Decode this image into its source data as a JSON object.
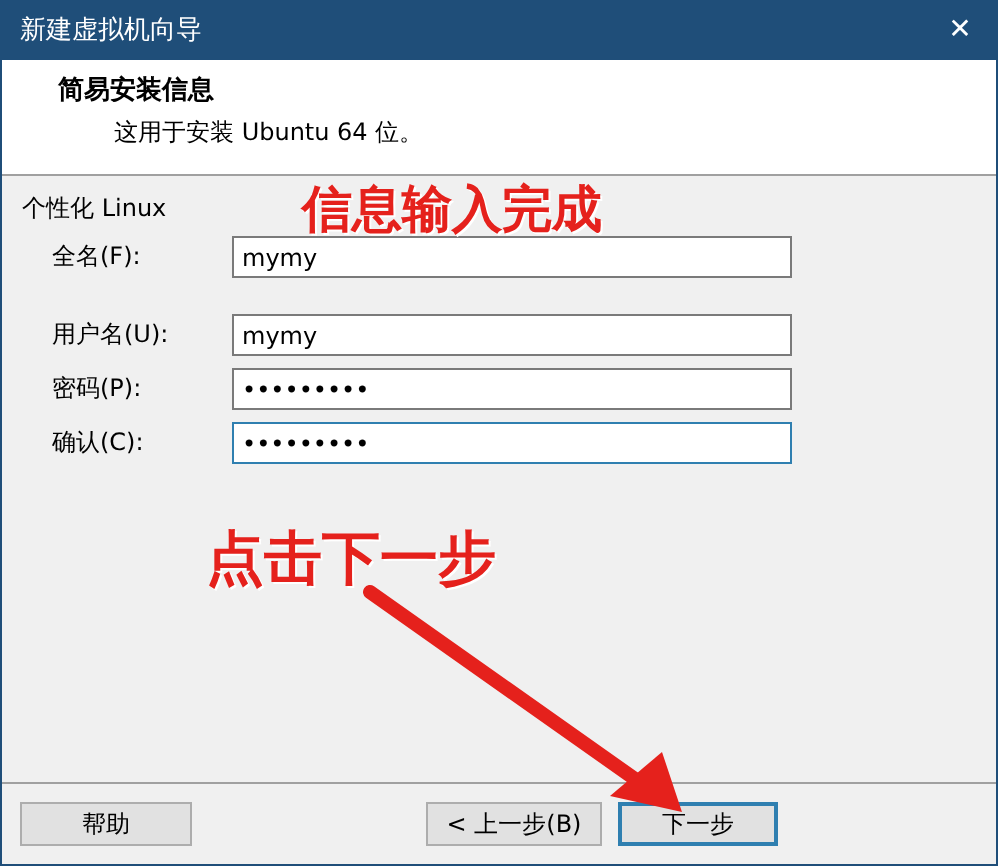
{
  "window": {
    "title": "新建虚拟机向导",
    "close": "✕"
  },
  "header": {
    "title": "简易安装信息",
    "subtitle": "这用于安装 Ubuntu 64 位。"
  },
  "group": {
    "label": "个性化 Linux"
  },
  "field_sections": [
    {
      "fields": [
        {
          "label": "全名(F):",
          "value": "mymy",
          "focused": false
        }
      ]
    },
    {
      "fields": [
        {
          "label": "用户名(U):",
          "value": "mymy",
          "focused": false
        },
        {
          "label": "密码(P):",
          "value": "•••••••••",
          "focused": false
        },
        {
          "label": "确认(C):",
          "value": "•••••••••",
          "focused": true
        }
      ]
    }
  ],
  "annotations": [
    {
      "kind": "heading",
      "text": "信息输入完成"
    },
    {
      "kind": "arrow-note",
      "text": "点击下一步"
    }
  ],
  "buttons": [
    {
      "label": "帮助",
      "default": false
    },
    {
      "label": "< 上一步(B)",
      "default": false
    },
    {
      "label": "下一步",
      "default": true
    }
  ]
}
